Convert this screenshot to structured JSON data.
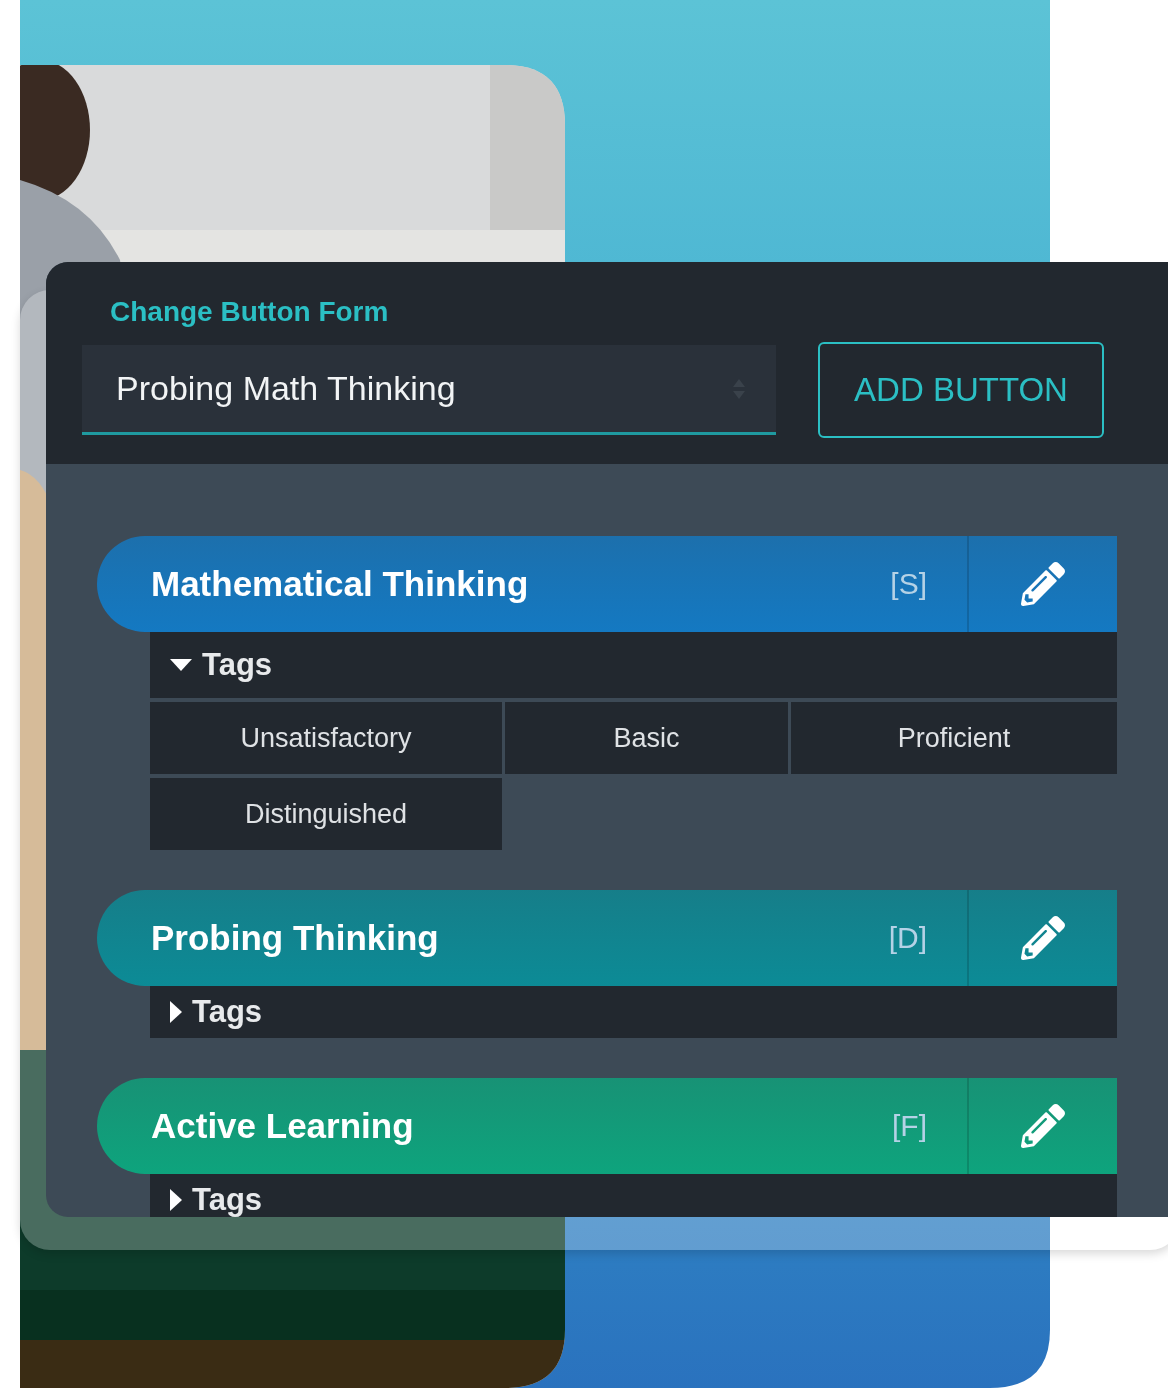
{
  "form": {
    "label": "Change Button Form",
    "select_value": "Probing Math Thinking",
    "add_button": "ADD BUTTON"
  },
  "buttons": [
    {
      "name": "Mathematical Thinking",
      "shortcut": "[S]",
      "color": "#1479c2",
      "tags_label": "Tags",
      "expanded": true,
      "tags": [
        "Unsatisfactory",
        "Basic",
        "Proficient",
        "Distinguished"
      ]
    },
    {
      "name": "Probing Thinking",
      "shortcut": "[D]",
      "color": "#0c8b96",
      "tags_label": "Tags",
      "expanded": false
    },
    {
      "name": "Active Learning",
      "shortcut": "[F]",
      "color": "#0ea47d",
      "tags_label": "Tags",
      "expanded": false
    }
  ]
}
